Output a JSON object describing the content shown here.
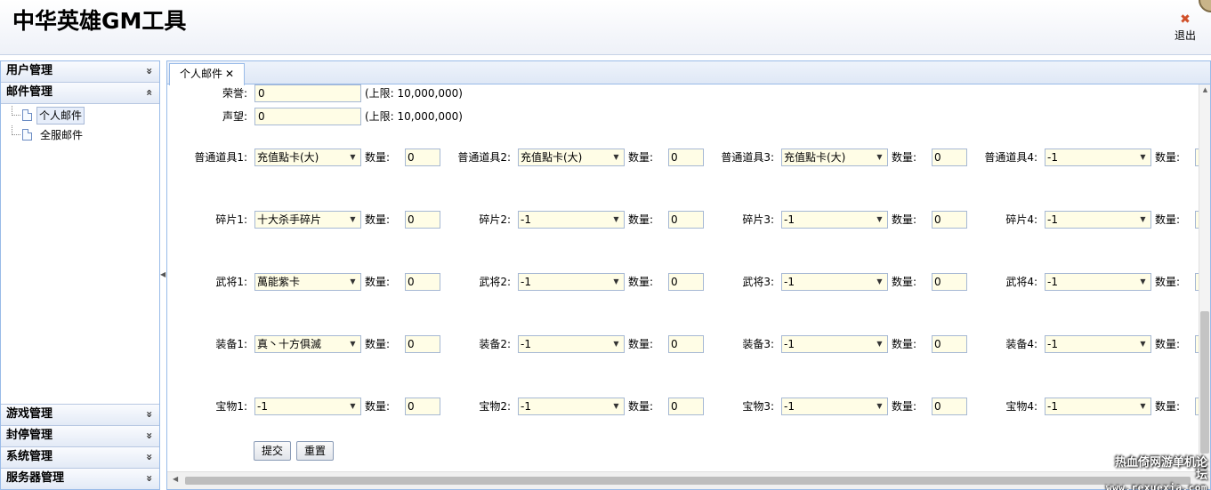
{
  "header": {
    "title": "中华英雄GM工具",
    "logout_label": "退出"
  },
  "sidebar": {
    "top_sections": [
      {
        "label": "用户管理",
        "chev": "»"
      },
      {
        "label": "邮件管理",
        "chev": "«"
      }
    ],
    "tree": [
      {
        "label": "个人邮件",
        "selected": true
      },
      {
        "label": "全服邮件",
        "selected": false
      }
    ],
    "bottom_sections": [
      {
        "label": "游戏管理",
        "chev": "»"
      },
      {
        "label": "封停管理",
        "chev": "»"
      },
      {
        "label": "系统管理",
        "chev": "»"
      },
      {
        "label": "服务器管理",
        "chev": "»"
      }
    ]
  },
  "tab": {
    "label": "个人邮件",
    "close": "✕"
  },
  "form": {
    "honor": {
      "label": "荣誉:",
      "value": "0",
      "hint": "(上限: 10,000,000)"
    },
    "prestige": {
      "label": "声望:",
      "value": "0",
      "hint": "(上限: 10,000,000)"
    },
    "qty_label": "数量:",
    "rows": [
      {
        "labels": [
          "普通道具1:",
          "普通道具2:",
          "普通道具3:",
          "普通道具4:"
        ],
        "values": [
          "充值點卡(大)",
          "充值點卡(大)",
          "充值點卡(大)",
          "-1"
        ],
        "qty": [
          "0",
          "0",
          "0"
        ]
      },
      {
        "labels": [
          "碎片1:",
          "碎片2:",
          "碎片3:",
          "碎片4:"
        ],
        "values": [
          "十大杀手碎片",
          "-1",
          "-1",
          "-1"
        ],
        "qty": [
          "0",
          "0",
          "0"
        ]
      },
      {
        "labels": [
          "武将1:",
          "武将2:",
          "武将3:",
          "武将4:"
        ],
        "values": [
          "萬能紫卡",
          "-1",
          "-1",
          "-1"
        ],
        "qty": [
          "0",
          "0",
          "0"
        ]
      },
      {
        "labels": [
          "装备1:",
          "装备2:",
          "装备3:",
          "装备4:"
        ],
        "values": [
          "真丶十方俱滅",
          "-1",
          "-1",
          "-1"
        ],
        "qty": [
          "0",
          "0",
          "0"
        ]
      },
      {
        "labels": [
          "宝物1:",
          "宝物2:",
          "宝物3:",
          "宝物4:"
        ],
        "values": [
          "-1",
          "-1",
          "-1",
          "-1"
        ],
        "qty": [
          "0",
          "0",
          "0"
        ]
      }
    ],
    "submit_label": "提交",
    "reset_label": "重置"
  },
  "watermark": {
    "line1": "热血倚网游单机论坛",
    "line2": "www.rexuexia.com"
  }
}
